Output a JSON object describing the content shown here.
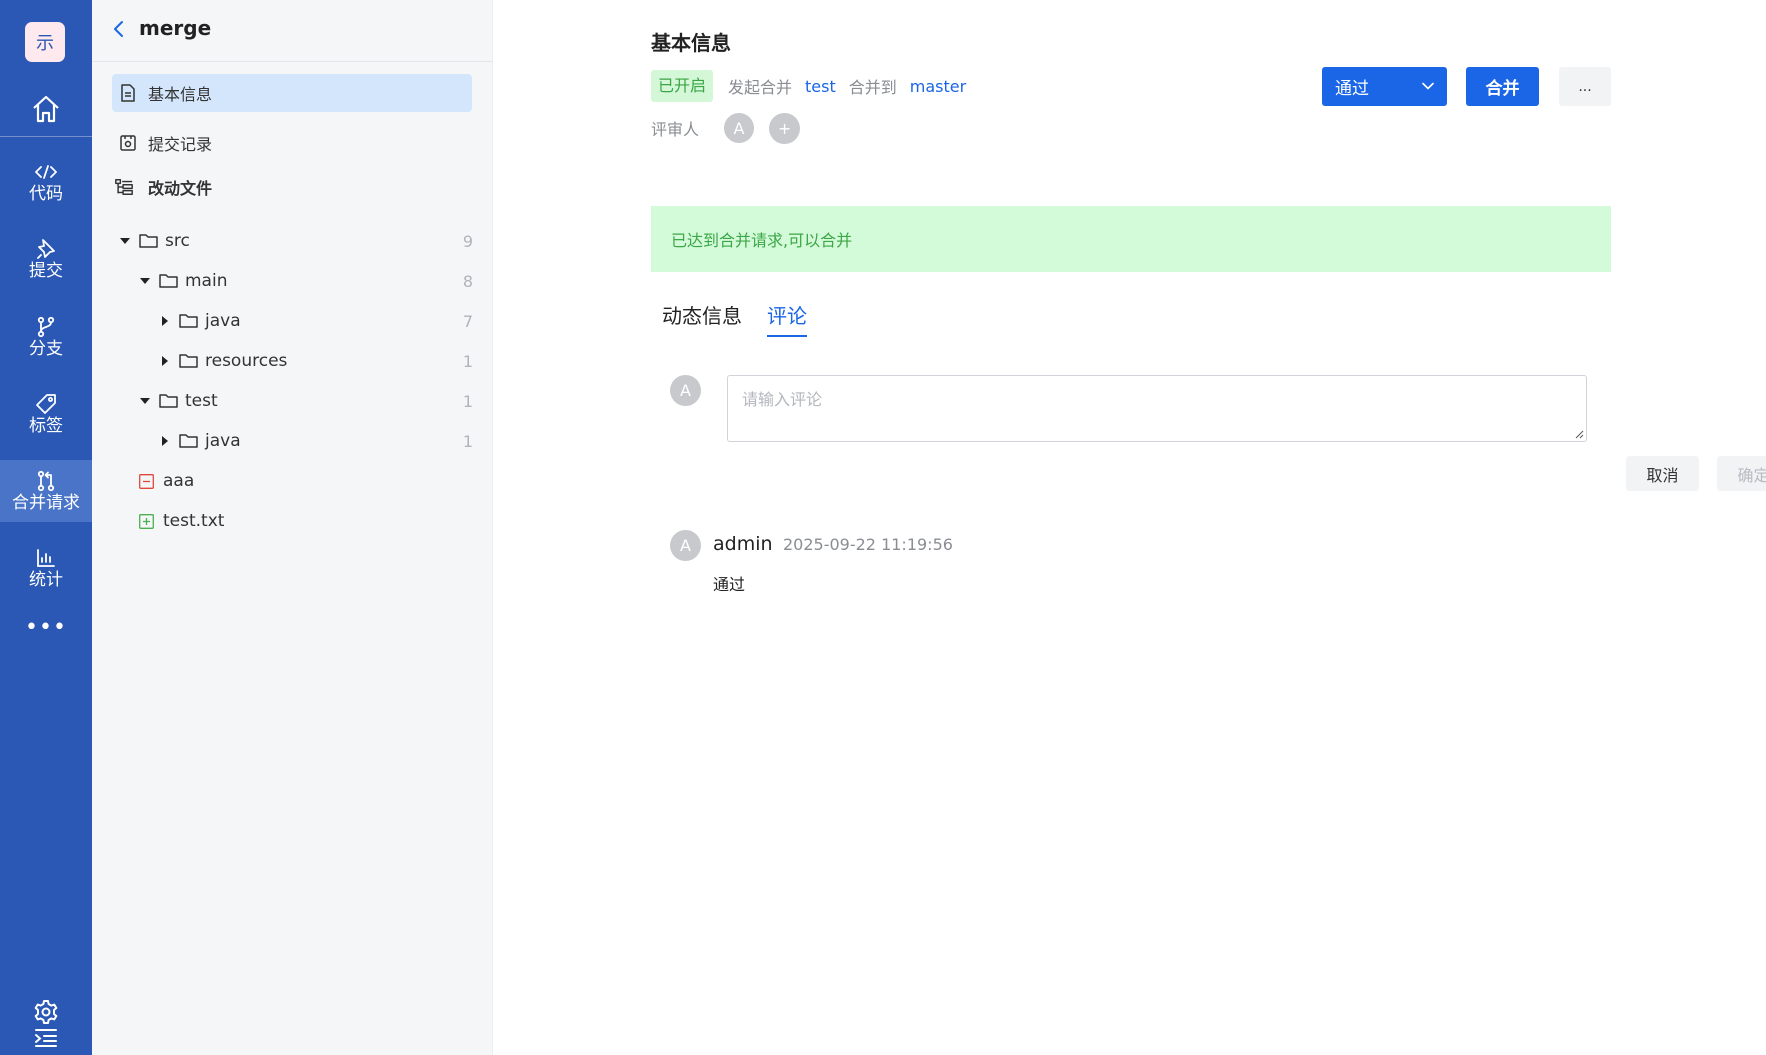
{
  "brand": {
    "logo_glyph": "示"
  },
  "rail": {
    "items": [
      {
        "label": "代码",
        "icon": "code-icon"
      },
      {
        "label": "提交",
        "icon": "pin-icon"
      },
      {
        "label": "分支",
        "icon": "branch-icon"
      },
      {
        "label": "标签",
        "icon": "tag-icon"
      },
      {
        "label": "合并请求",
        "icon": "merge-request-icon",
        "active": true
      },
      {
        "label": "统计",
        "icon": "bar-chart-icon"
      }
    ],
    "more": "•••"
  },
  "panel": {
    "title": "merge",
    "nav": [
      {
        "label": "基本信息",
        "icon": "document-icon",
        "selected": true
      },
      {
        "label": "提交记录",
        "icon": "commit-record-icon"
      },
      {
        "label": "改动文件",
        "icon": "changed-files-icon"
      }
    ],
    "tree": [
      {
        "name": "src",
        "type": "folder",
        "expanded": true,
        "count": "9"
      },
      {
        "name": "main",
        "type": "folder",
        "expanded": true,
        "count": "8"
      },
      {
        "name": "java",
        "type": "folder",
        "expanded": false,
        "count": "7"
      },
      {
        "name": "resources",
        "type": "folder",
        "expanded": false,
        "count": "1"
      },
      {
        "name": "test",
        "type": "folder",
        "expanded": true,
        "count": "1"
      },
      {
        "name": "java",
        "type": "folder",
        "expanded": false,
        "count": "1"
      },
      {
        "name": "aaa",
        "type": "file-deleted"
      },
      {
        "name": "test.txt",
        "type": "file-added"
      }
    ]
  },
  "main": {
    "title": "基本信息",
    "status": "已开启",
    "initiate_label": "发起合并",
    "source_branch": "test",
    "merge_to_label": "合并到",
    "target_branch": "master",
    "reviewer_label": "评审人",
    "reviewer_initial": "A",
    "add_reviewer": "+",
    "approve_button": "通过",
    "merge_button": "合并",
    "more_button": "...",
    "alert": "已达到合并请求,可以合并",
    "tabs": [
      {
        "label": "动态信息",
        "active": false
      },
      {
        "label": "评论",
        "active": true
      }
    ],
    "comment": {
      "avatar_initial": "A",
      "placeholder": "请输入评论",
      "value": "",
      "cancel_label": "取消",
      "confirm_label": "确定"
    },
    "entries": [
      {
        "avatar_initial": "A",
        "author": "admin",
        "time": "2025-09-22 11:19:56",
        "body": "通过"
      }
    ]
  },
  "colors": {
    "rail_bg": "#2b58b4",
    "rail_active": "#4a74c8",
    "primary": "#1a66e6",
    "success_bg": "#d4fbd9",
    "success_text": "#3ba746",
    "deleted": "#e0473c",
    "added": "#4caf50"
  }
}
